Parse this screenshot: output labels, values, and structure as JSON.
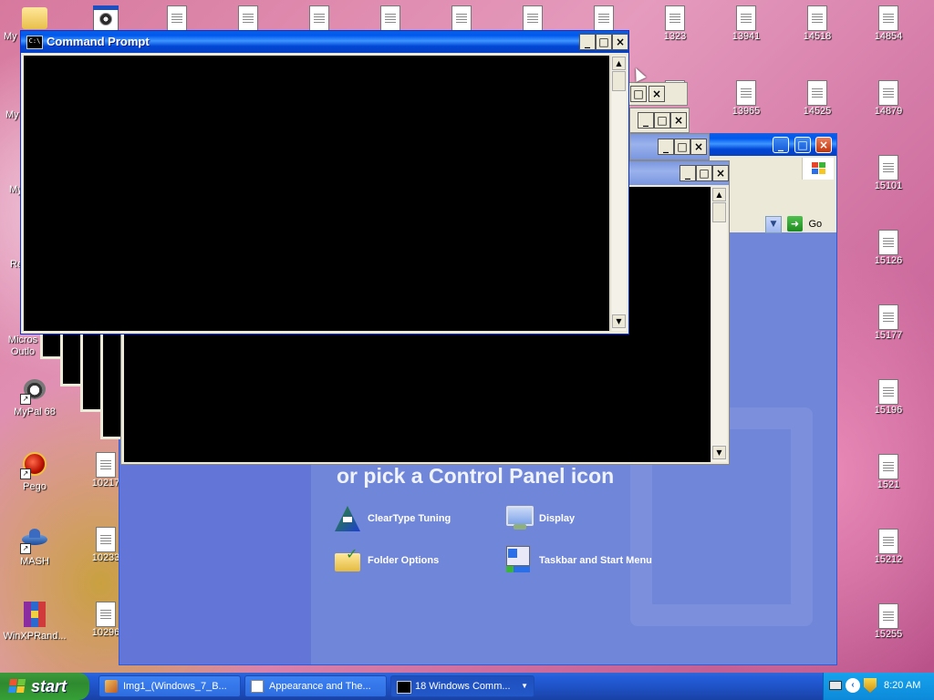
{
  "desktop": {
    "left_icons": [
      {
        "label": "My"
      },
      {
        "label": "My"
      },
      {
        "label": "My"
      },
      {
        "label": "Re"
      },
      {
        "label": "Micros Outlo"
      },
      {
        "label": "MyPal 68"
      },
      {
        "label": "Pego"
      },
      {
        "label": "MASH"
      },
      {
        "label": "WinXPRand..."
      }
    ],
    "col2_icons": [
      {
        "label": "10217"
      },
      {
        "label": "10233"
      },
      {
        "label": "10296"
      }
    ],
    "right_icons": [
      {
        "label": "1323"
      },
      {
        "label": "13941"
      },
      {
        "label": "14518"
      },
      {
        "label": "14854"
      },
      {
        "label": "13965"
      },
      {
        "label": "14525"
      },
      {
        "label": "14879"
      },
      {
        "label": "15101"
      },
      {
        "label": "15126"
      },
      {
        "label": "15177"
      },
      {
        "label": "15196"
      },
      {
        "label": "1521"
      },
      {
        "label": "15212"
      },
      {
        "label": "15255"
      }
    ]
  },
  "cmd_window": {
    "title": "Command Prompt",
    "minimize": "_",
    "maximize": "□",
    "close": "×"
  },
  "control_panel": {
    "heading": "or pick a Control Panel icon",
    "items": [
      {
        "label": "ClearType Tuning"
      },
      {
        "label": "Display"
      },
      {
        "label": "Folder Options"
      },
      {
        "label": "Taskbar and Start Menu"
      }
    ],
    "go_label": "Go"
  },
  "taskbar": {
    "start_label": "start",
    "items": [
      {
        "label": "Img1_(Windows_7_B..."
      },
      {
        "label": "Appearance and The..."
      },
      {
        "label": "18 Windows Comm..."
      }
    ],
    "clock": "8:20 AM"
  }
}
